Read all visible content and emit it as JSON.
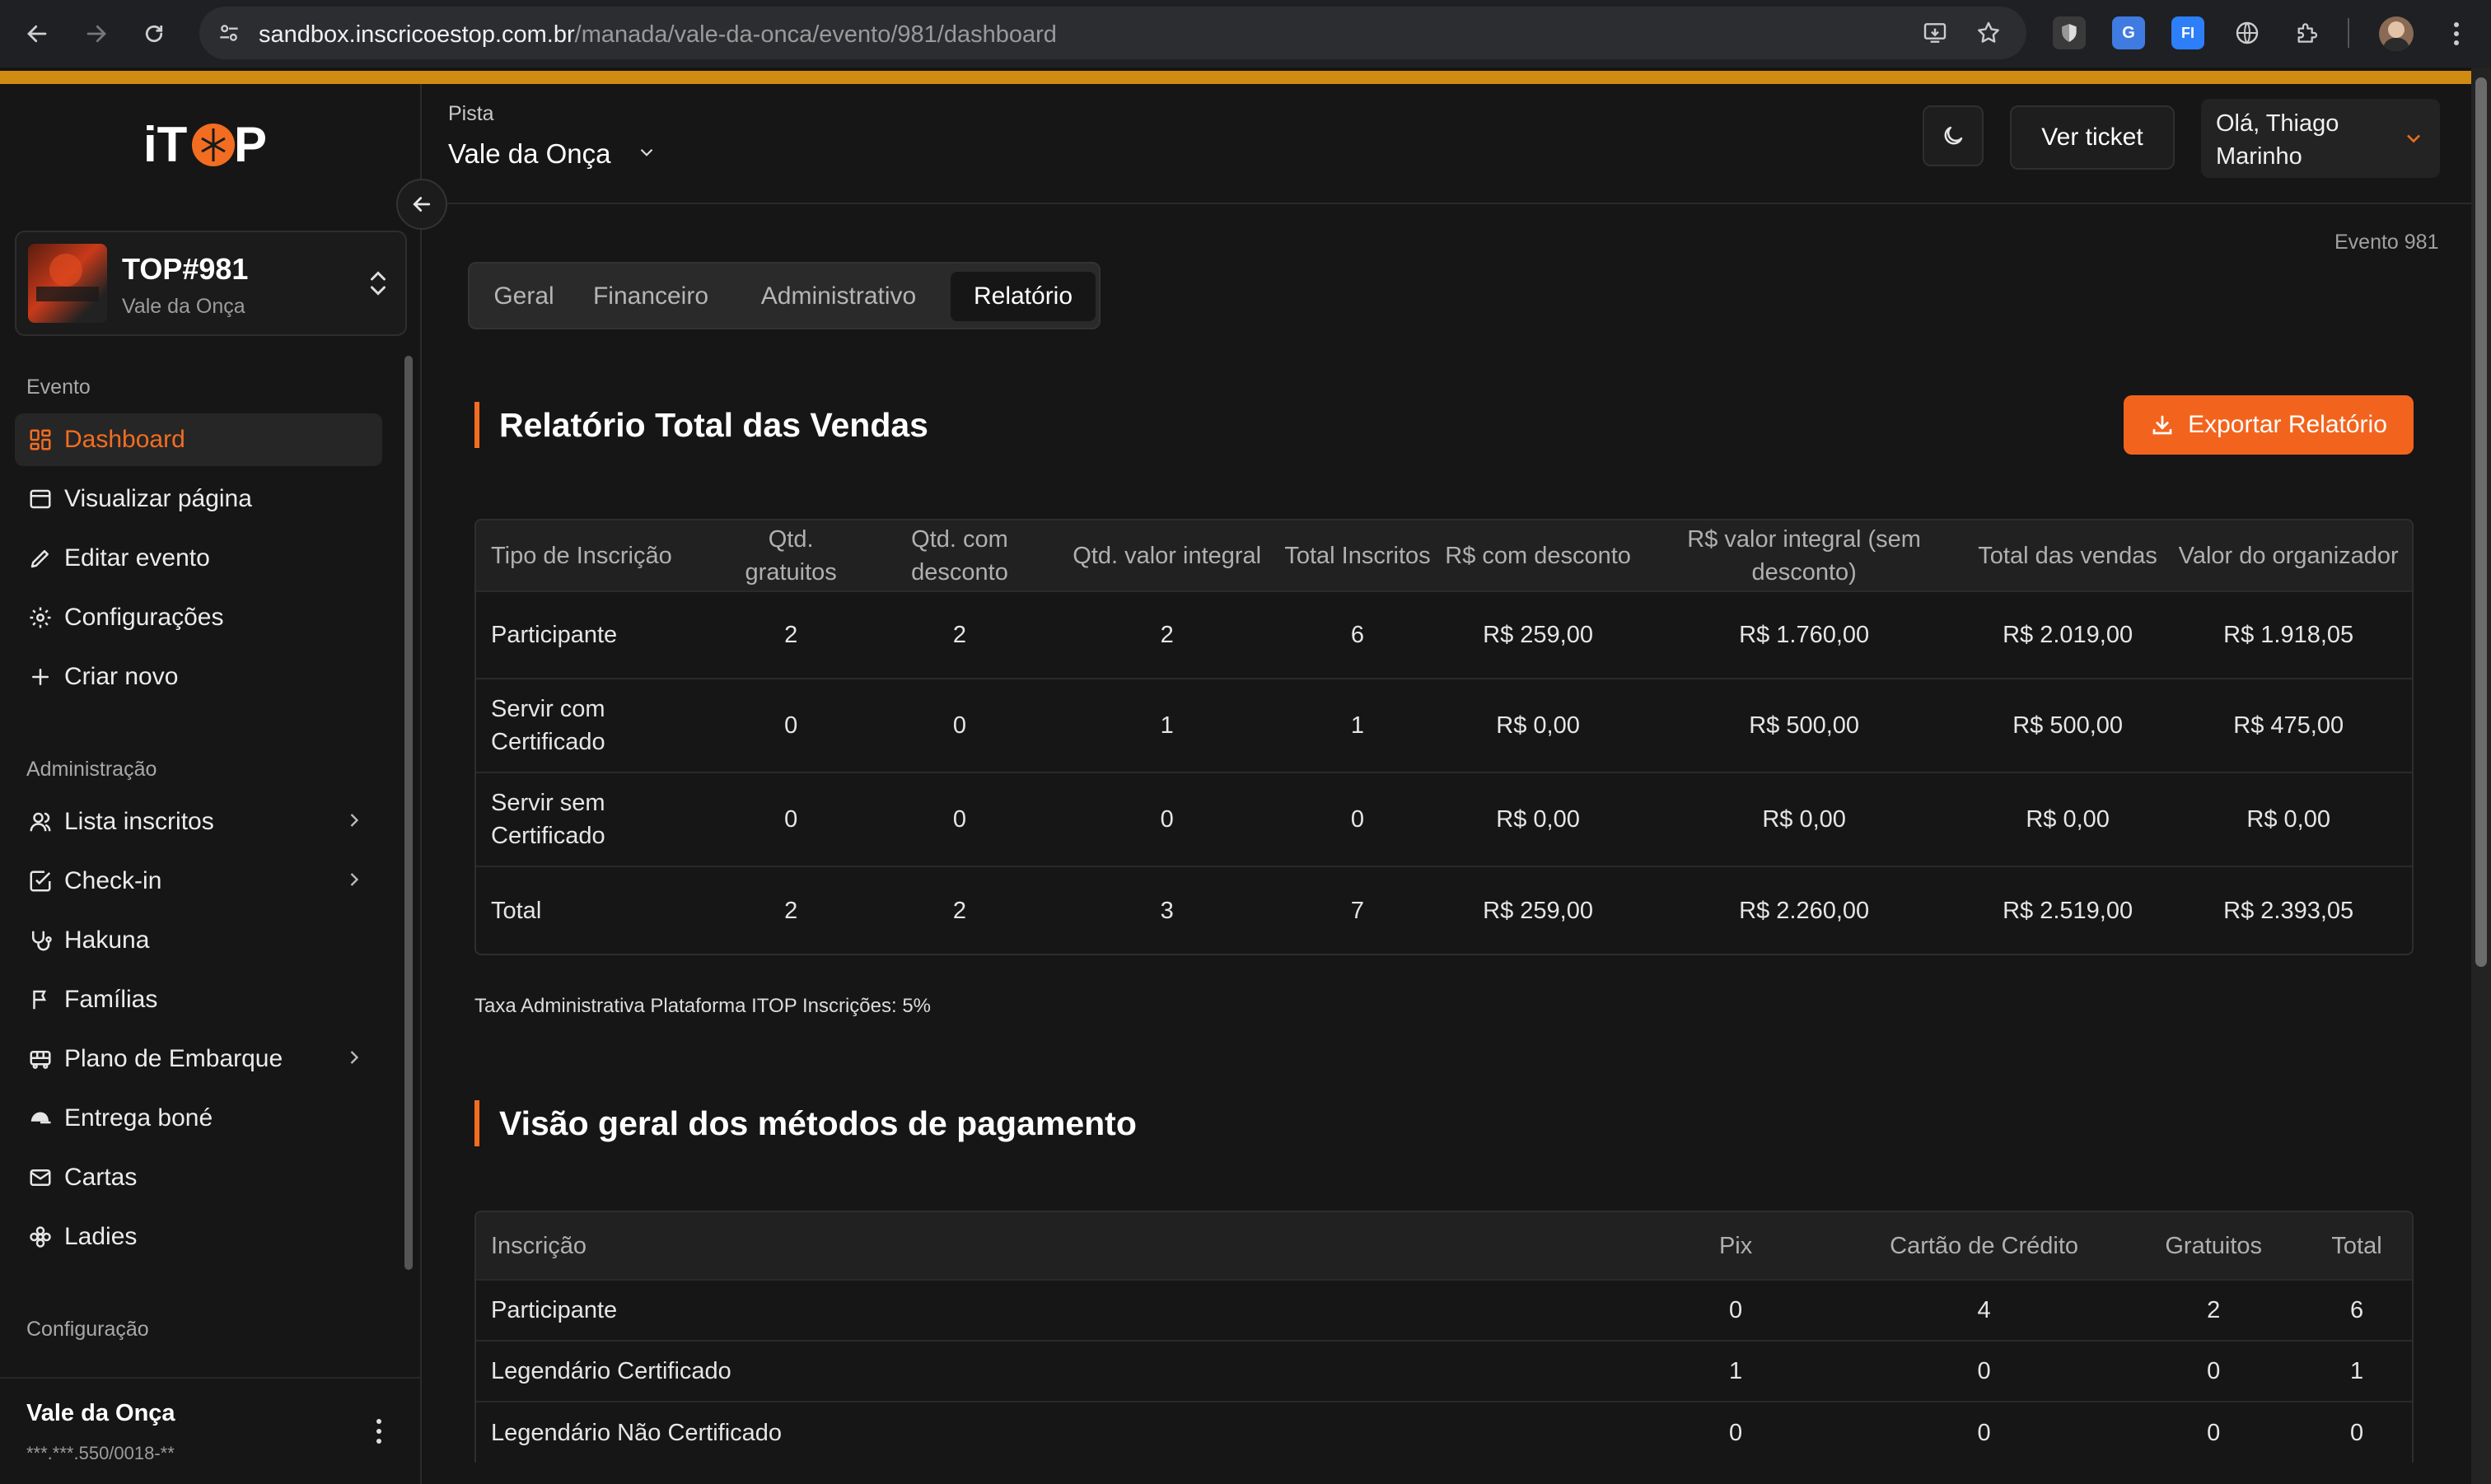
{
  "browser": {
    "url_host": "sandbox.inscricoestop.com.br",
    "url_path": "/manada/vale-da-onca/evento/981/dashboard"
  },
  "sidebar": {
    "logo_text": "iTOP",
    "event_card": {
      "title": "TOP#981",
      "subtitle": "Vale da Onça"
    },
    "section_evento": "Evento",
    "evento_items": [
      {
        "label": "Dashboard",
        "icon": "dashboard-icon",
        "active": true
      },
      {
        "label": "Visualizar página",
        "icon": "browser-window-icon"
      },
      {
        "label": "Editar evento",
        "icon": "pencil-icon"
      },
      {
        "label": "Configurações",
        "icon": "gear-icon"
      },
      {
        "label": "Criar novo",
        "icon": "plus-icon"
      }
    ],
    "section_admin": "Administração",
    "admin_items": [
      {
        "label": "Lista inscritos",
        "icon": "users-icon",
        "has_submenu": true
      },
      {
        "label": "Check-in",
        "icon": "check-square-icon",
        "has_submenu": true
      },
      {
        "label": "Hakuna",
        "icon": "stethoscope-icon"
      },
      {
        "label": "Famílias",
        "icon": "flag-icon"
      },
      {
        "label": "Plano de Embarque",
        "icon": "bus-icon",
        "has_submenu": true
      },
      {
        "label": "Entrega boné",
        "icon": "cap-icon"
      },
      {
        "label": "Cartas",
        "icon": "mail-icon"
      },
      {
        "label": "Ladies",
        "icon": "flower-icon"
      }
    ],
    "section_config": "Configuração",
    "footer": {
      "name": "Vale da Onça",
      "doc": "***.***.550/0018-**"
    }
  },
  "header": {
    "pista_label": "Pista",
    "pista_value": "Vale da Onça",
    "ticket_button": "Ver ticket",
    "user_greeting": "Olá, Thiago Marinho"
  },
  "main": {
    "evento_tag": "Evento 981",
    "tabs": [
      "Geral",
      "Financeiro",
      "Administrativo",
      "Relatório"
    ],
    "active_tab": "Relatório",
    "sales": {
      "title": "Relatório Total das Vendas",
      "export_button": "Exportar Relatório",
      "headers": [
        "Tipo de Inscrição",
        "Qtd. gratuitos",
        "Qtd. com desconto",
        "Qtd. valor integral",
        "Total Inscritos",
        "R$ com desconto",
        "R$ valor integral (sem desconto)",
        "Total das vendas",
        "Valor do organizador"
      ],
      "rows": [
        [
          "Participante",
          "2",
          "2",
          "2",
          "6",
          "R$ 259,00",
          "R$ 1.760,00",
          "R$ 2.019,00",
          "R$ 1.918,05"
        ],
        [
          "Servir com Certificado",
          "0",
          "0",
          "1",
          "1",
          "R$ 0,00",
          "R$ 500,00",
          "R$ 500,00",
          "R$ 475,00"
        ],
        [
          "Servir sem Certificado",
          "0",
          "0",
          "0",
          "0",
          "R$ 0,00",
          "R$ 0,00",
          "R$ 0,00",
          "R$ 0,00"
        ],
        [
          "Total",
          "2",
          "2",
          "3",
          "7",
          "R$ 259,00",
          "R$ 2.260,00",
          "R$ 2.519,00",
          "R$ 2.393,05"
        ]
      ],
      "taxa_note": "Taxa Administrativa Plataforma ITOP Inscrições: 5%"
    },
    "payments": {
      "title": "Visão geral dos métodos de pagamento",
      "headers": [
        "Inscrição",
        "Pix",
        "Cartão de Crédito",
        "Gratuitos",
        "Total"
      ],
      "rows": [
        [
          "Participante",
          "0",
          "4",
          "2",
          "6"
        ],
        [
          "Legendário Certificado",
          "1",
          "0",
          "0",
          "1"
        ],
        [
          "Legendário Não Certificado",
          "0",
          "0",
          "0",
          "0"
        ]
      ]
    }
  },
  "colors": {
    "accent": "#f26d21",
    "strip": "#d08b12",
    "background": "#161616"
  }
}
